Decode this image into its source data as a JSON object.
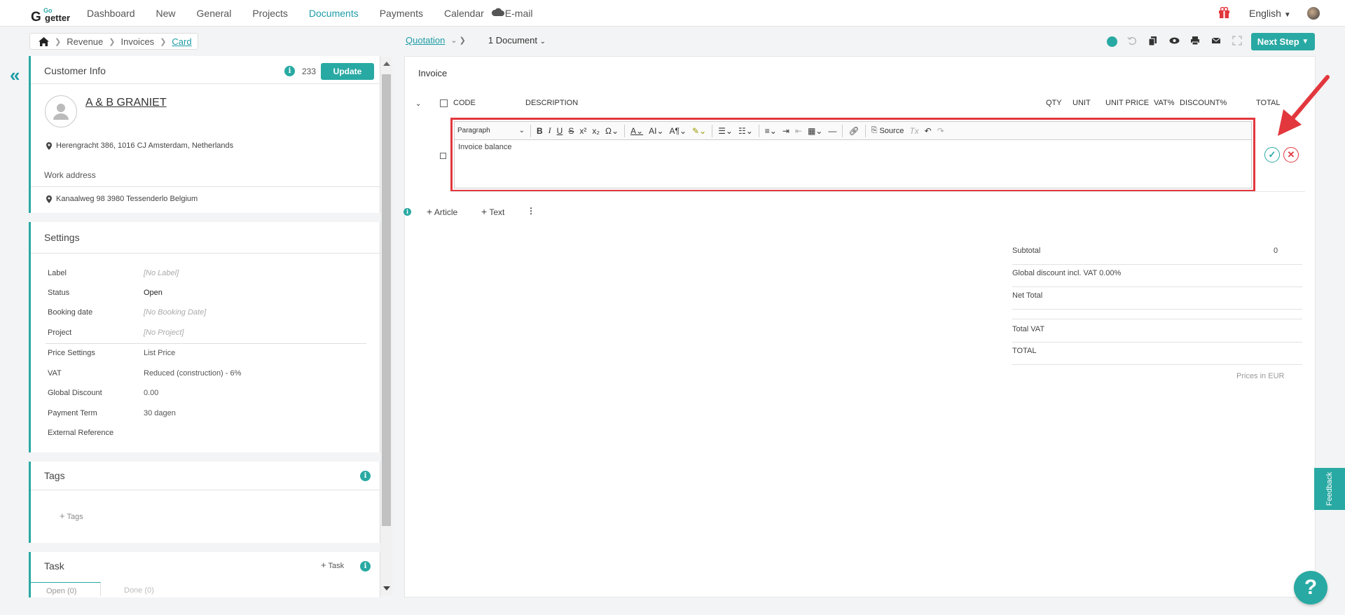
{
  "nav": {
    "items": [
      "Dashboard",
      "New",
      "General",
      "Projects",
      "Documents",
      "Payments",
      "Calendar",
      "E-mail"
    ],
    "active": "Documents",
    "language": "English"
  },
  "breadcrumb": [
    "Revenue",
    "Invoices",
    "Card"
  ],
  "doc_nav": {
    "quotation": "Quotation",
    "documents": "1 Document"
  },
  "toolbar": {
    "next_step": "Next Step"
  },
  "customer": {
    "title": "Customer Info",
    "count": "233",
    "update_label": "Update",
    "name": "A & B GRANIET",
    "address": "Herengracht 386, 1016 CJ Amsterdam, Netherlands",
    "work_address_label": "Work address",
    "work_address": "Kanaalweg 98 3980 Tessenderlo Belgium"
  },
  "settings": {
    "title": "Settings",
    "rows": [
      {
        "label": "Label",
        "value": "[No Label]"
      },
      {
        "label": "Status",
        "value": "Open"
      },
      {
        "label": "Booking date",
        "value": "[No Booking Date]"
      },
      {
        "label": "Project",
        "value": "[No Project]"
      },
      {
        "label": "Price Settings",
        "value": "List Price"
      },
      {
        "label": "VAT",
        "value": "Reduced (construction) - 6%"
      },
      {
        "label": "Global Discount",
        "value": "0.00"
      },
      {
        "label": "Payment Term",
        "value": "30 dagen"
      },
      {
        "label": "External Reference",
        "value": ""
      }
    ]
  },
  "tags": {
    "title": "Tags",
    "add_label": "Tags"
  },
  "task": {
    "title": "Task",
    "add_label": "Task",
    "tabs": [
      "Open (0)",
      "Done (0)"
    ]
  },
  "invoice": {
    "title": "Invoice",
    "columns": [
      "CODE",
      "DESCRIPTION",
      "QTY",
      "UNIT",
      "UNIT PRICE",
      "VAT%",
      "DISCOUNT%",
      "TOTAL"
    ],
    "editor": {
      "paragraph": "Paragraph",
      "source": "Source",
      "content": "Invoice balance"
    },
    "add_article": "Article",
    "add_text": "Text",
    "totals": [
      {
        "label": "Subtotal",
        "value": "0"
      },
      {
        "label": "Global discount incl. VAT 0.00%",
        "value": ""
      },
      {
        "label": "Net Total",
        "value": ""
      },
      {
        "label": "Total VAT",
        "value": ""
      },
      {
        "label": "TOTAL",
        "value": ""
      }
    ],
    "prices_in": "Prices in EUR"
  },
  "feedback_label": "Feedback",
  "help_label": "?",
  "colors": {
    "accent": "#29a9a3",
    "highlight": "#e2373d"
  }
}
